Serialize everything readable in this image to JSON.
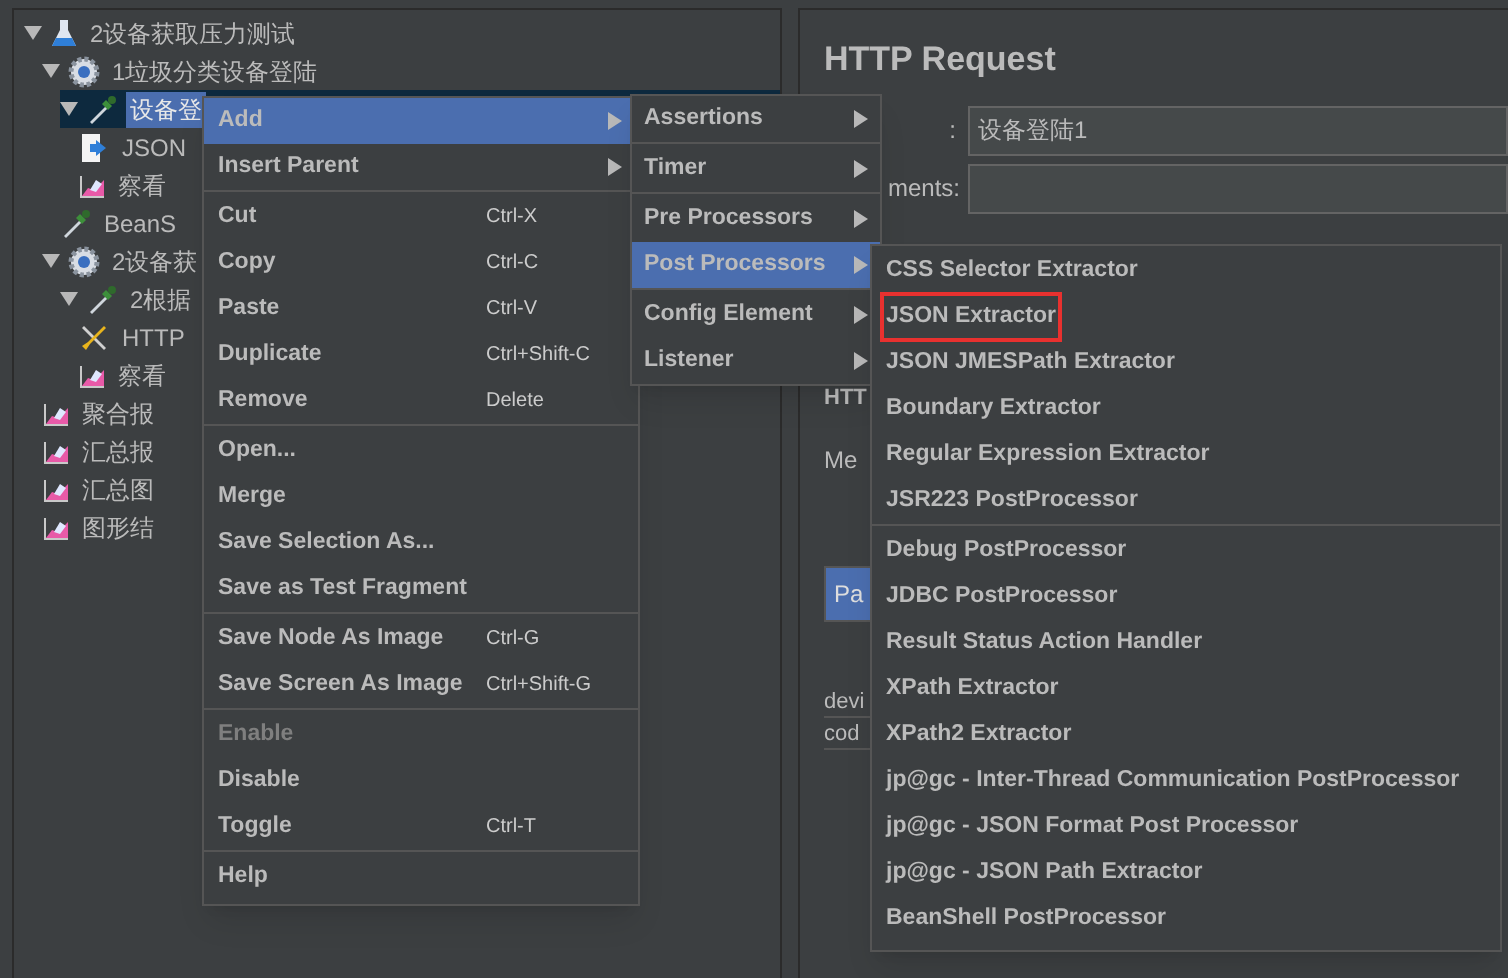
{
  "tree": [
    {
      "label": "2设备获取压力测试",
      "kind": "test_plan",
      "expanded": true,
      "selected": false,
      "children": [
        {
          "label": "1垃圾分类设备登陆",
          "kind": "thread_group",
          "expanded": true,
          "selected": false,
          "children": [
            {
              "label": "设备登",
              "kind": "sampler",
              "expanded": true,
              "selected": true,
              "children": [
                {
                  "label": "JSON",
                  "kind": "extractor",
                  "selected": false
                },
                {
                  "label": "察看",
                  "kind": "listener",
                  "selected": false
                }
              ]
            },
            {
              "label": "BeanS",
              "kind": "sampler",
              "selected": false
            }
          ]
        },
        {
          "label": "2设备获",
          "kind": "thread_group",
          "expanded": true,
          "selected": false,
          "children": [
            {
              "label": "2根据",
              "kind": "sampler",
              "expanded": true,
              "selected": false,
              "children": [
                {
                  "label": "HTTP",
                  "kind": "config",
                  "selected": false
                },
                {
                  "label": "察看",
                  "kind": "listener",
                  "selected": false
                }
              ]
            }
          ]
        },
        {
          "label": "聚合报",
          "kind": "listener",
          "selected": false
        },
        {
          "label": "汇总报",
          "kind": "listener",
          "selected": false
        },
        {
          "label": "汇总图",
          "kind": "listener",
          "selected": false
        },
        {
          "label": "图形结",
          "kind": "listener",
          "selected": false
        }
      ]
    }
  ],
  "panel": {
    "title": "HTTP Request",
    "name_label": ":",
    "name_value": "设备登陆1",
    "comments_label": "ments:",
    "section_label": "HTT",
    "method_label": "Me",
    "tab_label": "Pa",
    "cells": [
      "devi",
      "cod"
    ]
  },
  "context_menu": {
    "groups": [
      [
        {
          "label": "Add",
          "submenu": true,
          "selected": true,
          "disabled": false
        },
        {
          "label": "Insert Parent",
          "submenu": true,
          "selected": false,
          "disabled": false
        }
      ],
      [
        {
          "label": "Cut",
          "shortcut": "Ctrl-X",
          "submenu": false,
          "selected": false,
          "disabled": false
        },
        {
          "label": "Copy",
          "shortcut": "Ctrl-C",
          "submenu": false,
          "selected": false,
          "disabled": false
        },
        {
          "label": "Paste",
          "shortcut": "Ctrl-V",
          "submenu": false,
          "selected": false,
          "disabled": false
        },
        {
          "label": "Duplicate",
          "shortcut": "Ctrl+Shift-C",
          "submenu": false,
          "selected": false,
          "disabled": false
        },
        {
          "label": "Remove",
          "shortcut": "Delete",
          "submenu": false,
          "selected": false,
          "disabled": false
        }
      ],
      [
        {
          "label": "Open...",
          "submenu": false,
          "selected": false,
          "disabled": false
        },
        {
          "label": "Merge",
          "submenu": false,
          "selected": false,
          "disabled": false
        },
        {
          "label": "Save Selection As...",
          "submenu": false,
          "selected": false,
          "disabled": false
        },
        {
          "label": "Save as Test Fragment",
          "submenu": false,
          "selected": false,
          "disabled": false
        }
      ],
      [
        {
          "label": "Save Node As Image",
          "shortcut": "Ctrl-G",
          "submenu": false,
          "selected": false,
          "disabled": false
        },
        {
          "label": "Save Screen As Image",
          "shortcut": "Ctrl+Shift-G",
          "submenu": false,
          "selected": false,
          "disabled": false
        }
      ],
      [
        {
          "label": "Enable",
          "submenu": false,
          "selected": false,
          "disabled": true
        },
        {
          "label": "Disable",
          "submenu": false,
          "selected": false,
          "disabled": false
        },
        {
          "label": "Toggle",
          "shortcut": "Ctrl-T",
          "submenu": false,
          "selected": false,
          "disabled": false
        }
      ],
      [
        {
          "label": "Help",
          "submenu": false,
          "selected": false,
          "disabled": false
        }
      ]
    ]
  },
  "add_submenu": {
    "groups": [
      [
        {
          "label": "Assertions",
          "submenu": true,
          "selected": false
        }
      ],
      [
        {
          "label": "Timer",
          "submenu": true,
          "selected": false
        }
      ],
      [
        {
          "label": "Pre Processors",
          "submenu": true,
          "selected": false
        },
        {
          "label": "Post Processors",
          "submenu": true,
          "selected": true
        }
      ],
      [
        {
          "label": "Config Element",
          "submenu": true,
          "selected": false
        },
        {
          "label": "Listener",
          "submenu": true,
          "selected": false
        }
      ]
    ]
  },
  "post_processors_submenu": {
    "groups": [
      [
        {
          "label": "CSS Selector Extractor",
          "marked": false
        },
        {
          "label": "JSON Extractor",
          "marked": true
        },
        {
          "label": "JSON JMESPath Extractor",
          "marked": false
        },
        {
          "label": "Boundary Extractor",
          "marked": false
        },
        {
          "label": "Regular Expression Extractor",
          "marked": false
        },
        {
          "label": "JSR223 PostProcessor",
          "marked": false
        }
      ],
      [
        {
          "label": "Debug PostProcessor",
          "marked": false
        },
        {
          "label": "JDBC PostProcessor",
          "marked": false
        },
        {
          "label": "Result Status Action Handler",
          "marked": false
        },
        {
          "label": "XPath Extractor",
          "marked": false
        },
        {
          "label": "XPath2 Extractor",
          "marked": false
        },
        {
          "label": "jp@gc - Inter-Thread Communication PostProcessor",
          "marked": false
        },
        {
          "label": "jp@gc - JSON Format Post Processor",
          "marked": false
        },
        {
          "label": "jp@gc - JSON Path Extractor",
          "marked": false
        },
        {
          "label": "BeanShell PostProcessor",
          "marked": false
        }
      ]
    ]
  }
}
